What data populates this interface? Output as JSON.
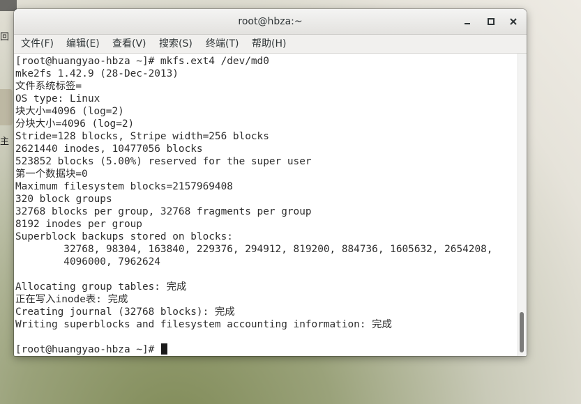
{
  "desktop": {
    "label_a": "回",
    "label_b": "主"
  },
  "window": {
    "title": "root@hbza:~"
  },
  "menubar": {
    "items": [
      "文件(F)",
      "编辑(E)",
      "查看(V)",
      "搜索(S)",
      "终端(T)",
      "帮助(H)"
    ]
  },
  "terminal": {
    "lines": [
      "[root@huangyao-hbza ~]# mkfs.ext4 /dev/md0",
      "mke2fs 1.42.9 (28-Dec-2013)",
      "文件系统标签=",
      "OS type: Linux",
      "块大小=4096 (log=2)",
      "分块大小=4096 (log=2)",
      "Stride=128 blocks, Stripe width=256 blocks",
      "2621440 inodes, 10477056 blocks",
      "523852 blocks (5.00%) reserved for the super user",
      "第一个数据块=0",
      "Maximum filesystem blocks=2157969408",
      "320 block groups",
      "32768 blocks per group, 32768 fragments per group",
      "8192 inodes per group",
      "Superblock backups stored on blocks:",
      "        32768, 98304, 163840, 229376, 294912, 819200, 884736, 1605632, 2654208,",
      "        4096000, 7962624",
      "",
      "Allocating group tables: 完成",
      "正在写入inode表: 完成",
      "Creating journal (32768 blocks): 完成",
      "Writing superblocks and filesystem accounting information: 完成",
      ""
    ],
    "prompt": "[root@huangyao-hbza ~]# "
  }
}
